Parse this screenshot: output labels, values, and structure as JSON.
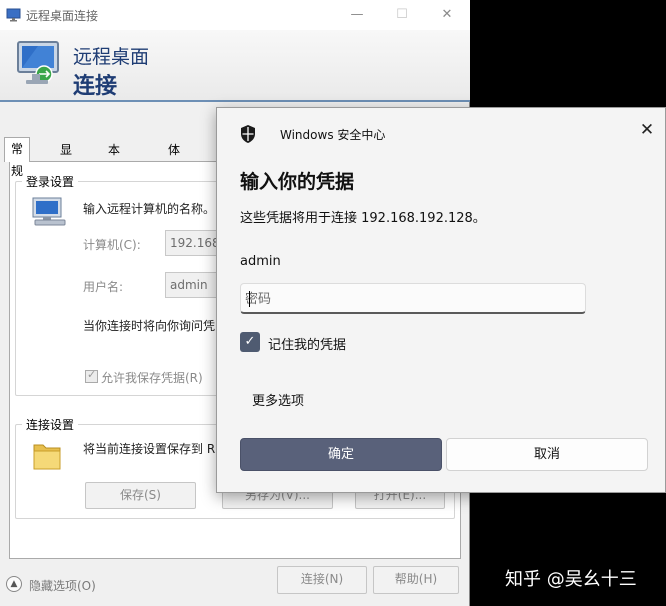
{
  "rdp": {
    "title": "远程桌面连接",
    "banner_line1": "远程桌面",
    "banner_line2": "连接",
    "tabs": [
      "常规",
      "显示",
      "本地资源",
      "体验"
    ],
    "login": {
      "group_label": "登录设置",
      "instruction": "输入远程计算机的名称。",
      "computer_label": "计算机(C):",
      "computer_value": "192.168",
      "username_label": "用户名:",
      "username_value": "admin",
      "prompt_text": "当你连接时将向你询问凭",
      "allow_save_label": "允许我保存凭据(R)"
    },
    "connection": {
      "group_label": "连接设置",
      "text": "将当前连接设置保存到 R",
      "save_button": "保存(S)",
      "saveas_button": "另存为(V)...",
      "open_button": "打开(E)..."
    },
    "hide_options": "隐藏选项(O)",
    "connect_button": "连接(N)",
    "help_button": "帮助(H)"
  },
  "credential": {
    "title": "Windows 安全中心",
    "heading": "输入你的凭据",
    "description": "这些凭据将用于连接 192.168.192.128。",
    "username": "admin",
    "password_placeholder": "密码",
    "remember_label": "记住我的凭据",
    "remember_checked": true,
    "more_options": "更多选项",
    "ok_button": "确定",
    "cancel_button": "取消"
  },
  "watermark": "知乎 @吴幺十三"
}
